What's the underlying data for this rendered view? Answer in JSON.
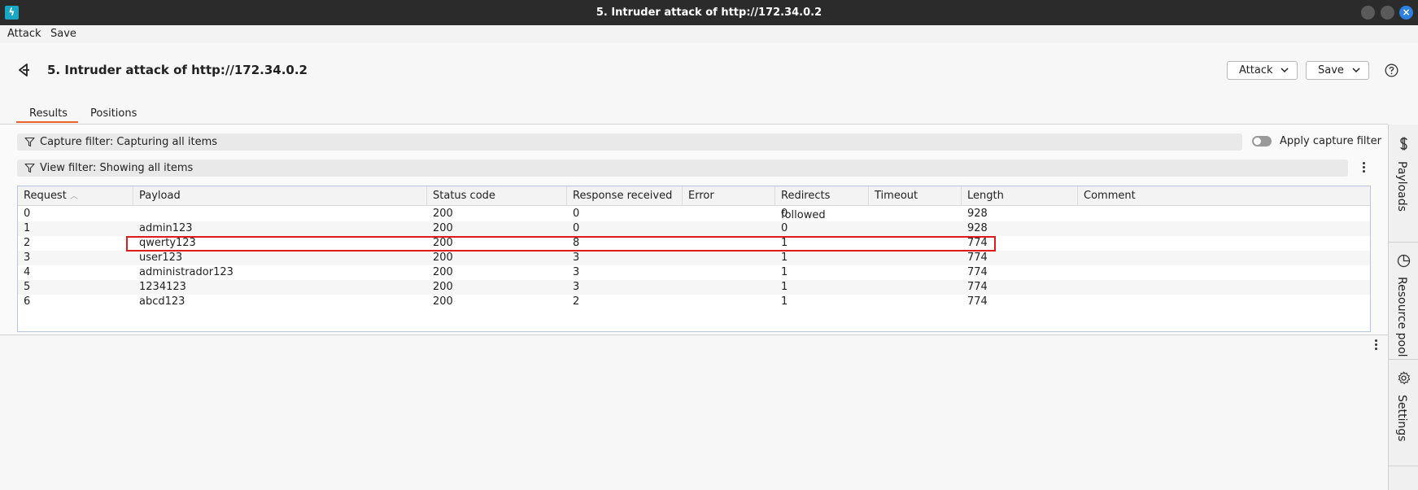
{
  "window": {
    "title": "5. Intruder attack of http://172.34.0.2",
    "app_icon": "burp-lightning-icon",
    "controls": [
      "minimize",
      "maximize",
      "close"
    ]
  },
  "menu": {
    "items": [
      "Attack",
      "Save"
    ]
  },
  "header": {
    "title": "5. Intruder attack of http://172.34.0.2",
    "attack_button": "Attack",
    "save_button": "Save"
  },
  "tabs": [
    {
      "label": "Results",
      "active": true
    },
    {
      "label": "Positions",
      "active": false
    }
  ],
  "capture_filter": {
    "label": "Capture filter: Capturing all items",
    "toggle_label": "Apply capture filter",
    "toggle_on": false
  },
  "view_filter": {
    "label": "View filter: Showing all items"
  },
  "table": {
    "columns": [
      "Request",
      "Payload",
      "Status code",
      "Response received",
      "Error",
      "Redirects followed",
      "Timeout",
      "Length",
      "Comment"
    ],
    "sort_column": "Request",
    "sort_direction": "ascending",
    "rows": [
      [
        "0",
        "",
        "200",
        "0",
        "",
        "0",
        "",
        "928",
        ""
      ],
      [
        "1",
        "admin123",
        "200",
        "0",
        "",
        "0",
        "",
        "928",
        ""
      ],
      [
        "2",
        "qwerty123",
        "200",
        "8",
        "",
        "1",
        "",
        "774",
        ""
      ],
      [
        "3",
        "user123",
        "200",
        "3",
        "",
        "1",
        "",
        "774",
        ""
      ],
      [
        "4",
        "administrador123",
        "200",
        "3",
        "",
        "1",
        "",
        "774",
        ""
      ],
      [
        "5",
        "1234123",
        "200",
        "3",
        "",
        "1",
        "",
        "774",
        ""
      ],
      [
        "6",
        "abcd123",
        "200",
        "2",
        "",
        "1",
        "",
        "774",
        ""
      ]
    ],
    "highlighted_row": 2,
    "highlight_color": "#e01b1b"
  },
  "sidebar": {
    "items": [
      {
        "label": "Payloads",
        "icon": "dollar-icon"
      },
      {
        "label": "Resource pool",
        "icon": "pie-chart-icon"
      },
      {
        "label": "Settings",
        "icon": "gear-icon"
      }
    ]
  },
  "colors": {
    "accent": "#e8622a",
    "titlebar": "#2b2b2b",
    "app_icon": "#1aa7c4",
    "close_button": "#2d7fe0"
  }
}
